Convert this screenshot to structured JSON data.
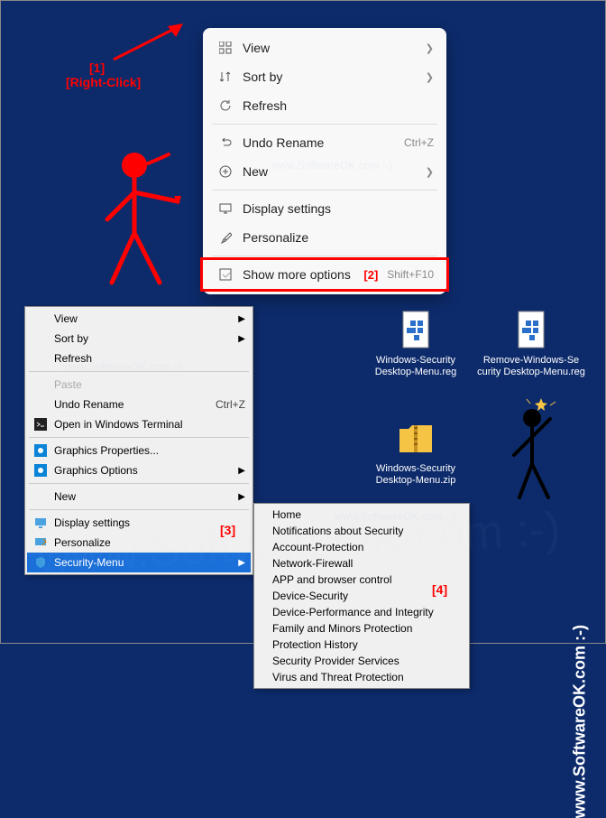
{
  "annotations": {
    "a1_num": "[1]",
    "a1_text": "[Right-Click]",
    "a2_num": "[2]",
    "a3_num": "[3]",
    "a4_num": "[4]"
  },
  "menuModern": {
    "items": [
      {
        "label": "View",
        "arrow": true
      },
      {
        "label": "Sort by",
        "arrow": true
      },
      {
        "label": "Refresh"
      }
    ],
    "items2": [
      {
        "label": "Undo Rename",
        "kbd": "Ctrl+Z"
      },
      {
        "label": "New",
        "arrow": true
      }
    ],
    "items3": [
      {
        "label": "Display settings"
      },
      {
        "label": "Personalize"
      }
    ],
    "items4": [
      {
        "label": "Show more options",
        "kbd": "Shift+F10"
      }
    ]
  },
  "menuClassic": {
    "g1": [
      {
        "label": "View",
        "arrow": true
      },
      {
        "label": "Sort by",
        "arrow": true
      },
      {
        "label": "Refresh"
      }
    ],
    "g2": [
      {
        "label": "Paste",
        "disabled": true
      },
      {
        "label": "Undo Rename",
        "kbd": "Ctrl+Z"
      },
      {
        "label": "Open in Windows Terminal",
        "icon": "terminal"
      }
    ],
    "g3": [
      {
        "label": "Graphics Properties...",
        "icon": "intel"
      },
      {
        "label": "Graphics Options",
        "icon": "intel",
        "arrow": true
      }
    ],
    "g4": [
      {
        "label": "New",
        "arrow": true
      }
    ],
    "g5": [
      {
        "label": "Display settings",
        "icon": "display"
      },
      {
        "label": "Personalize",
        "icon": "personalize"
      },
      {
        "label": "Security-Menu",
        "icon": "shield",
        "arrow": true,
        "selected": true
      }
    ]
  },
  "menuSecurity": [
    {
      "label": "Home"
    },
    {
      "label": "Notifications about Security"
    },
    {
      "label": "Account-Protection"
    },
    {
      "label": "Network-Firewall"
    },
    {
      "label": "APP and browser control"
    },
    {
      "label": "Device-Security"
    },
    {
      "label": "Device-Performance and Integrity"
    },
    {
      "label": "Family and Minors Protection"
    },
    {
      "label": "Protection History"
    },
    {
      "label": "Security Provider Services"
    },
    {
      "label": "Virus and Threat Protection"
    }
  ],
  "desktopIcons": [
    {
      "name": "Windows-Security Desktop-Menu.reg",
      "type": "reg"
    },
    {
      "name": "Remove-Windows-Se curity Desktop-Menu.reg",
      "type": "reg"
    },
    {
      "name": "Windows-Security Desktop-Menu.zip",
      "type": "zip"
    }
  ],
  "watermark": "www.SoftwareOK.com :-)",
  "sideText": "www.SoftwareOK.com :-)"
}
